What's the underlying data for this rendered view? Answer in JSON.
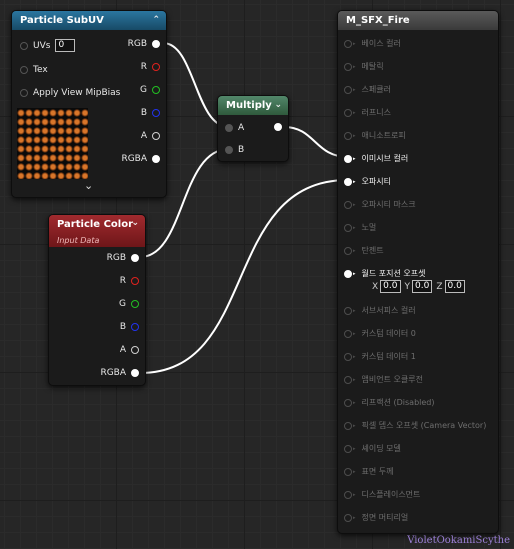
{
  "nodes": {
    "subuv": {
      "title": "Particle SubUV",
      "inputs": [
        {
          "label": "UVs",
          "value": "0"
        },
        {
          "label": "Tex"
        },
        {
          "label": "Apply View MipBias"
        }
      ],
      "outputs": [
        "RGB",
        "R",
        "G",
        "B",
        "A",
        "RGBA"
      ],
      "expand_glyph": "⌄",
      "collapse_glyph": "⌃"
    },
    "multiply": {
      "title": "Multiply",
      "inputs": [
        "A",
        "B"
      ],
      "collapse_glyph": "⌄"
    },
    "particle_color": {
      "title": "Particle Color",
      "subtitle": "Input Data",
      "outputs": [
        "RGB",
        "R",
        "G",
        "B",
        "A",
        "RGBA"
      ],
      "collapse_glyph": "⌄"
    },
    "material": {
      "title": "M_SFX_Fire",
      "inputs": [
        {
          "label": "베이스 컬러",
          "active": false
        },
        {
          "label": "메탈릭",
          "active": false
        },
        {
          "label": "스페큘러",
          "active": false
        },
        {
          "label": "러프니스",
          "active": false
        },
        {
          "label": "애니소트로피",
          "active": false
        },
        {
          "label": "이미시브 컬러",
          "active": true
        },
        {
          "label": "오파시티",
          "active": true
        },
        {
          "label": "오파시티 마스크",
          "active": false
        },
        {
          "label": "노멀",
          "active": false
        },
        {
          "label": "탄젠트",
          "active": false
        },
        {
          "label": "월드 포지션 오프셋",
          "active": true
        },
        {
          "label": "서브서피스 컬러",
          "active": false
        },
        {
          "label": "커스텀 데이터 0",
          "active": false
        },
        {
          "label": "커스텀 데이터 1",
          "active": false
        },
        {
          "label": "앰비언트 오클루전",
          "active": false
        },
        {
          "label": "리프랙션 (Disabled)",
          "active": false
        },
        {
          "label": "픽셀 뎁스 오프셋 (Camera Vector)",
          "active": false
        },
        {
          "label": "셰이딩 모델",
          "active": false
        },
        {
          "label": "표면 두께",
          "active": false
        },
        {
          "label": "디스플레이스먼트",
          "active": false
        },
        {
          "label": "정면 머티리얼",
          "active": false
        }
      ],
      "wpo_fields": {
        "x_label": "X",
        "x": "0.0",
        "y_label": "Y",
        "y": "0.0",
        "z_label": "Z",
        "z": "0.0"
      }
    }
  },
  "colors": {
    "subuv_header": "#1f5a7a",
    "multiply_header": "#3f6f4c",
    "particle_color_header": "#8a1f24",
    "material_header": "#4a4a4a",
    "pin_r": "#e0221e",
    "pin_g": "#22c022",
    "pin_b": "#2233ee",
    "pin_a": "#cfcfcf",
    "wire": "#ffffff"
  },
  "watermark": "VioletOokamiScythe"
}
